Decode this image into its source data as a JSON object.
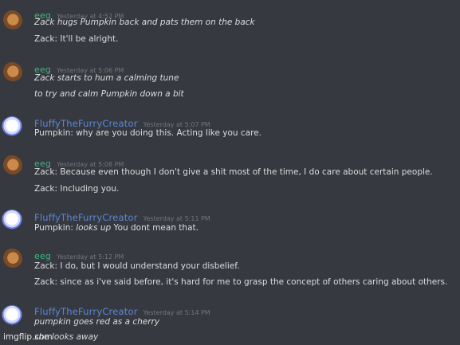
{
  "messages": [
    {
      "author": "eeg",
      "timestamp": "Yesterday at 4:52 PM",
      "lines": [
        "Zack hugs Pumpkin back and pats them on the back",
        "Zack: It'll be alright."
      ],
      "italic": [
        true,
        false
      ]
    },
    {
      "author": "eeg",
      "timestamp": "Yesterday at 5:06 PM",
      "lines": [
        "Zack starts to hum a calming tune",
        "to try and calm Pumpkin down a bit"
      ],
      "italic": [
        true,
        true
      ]
    },
    {
      "author": "FluffyTheFurryCreator",
      "timestamp": "Yesterday at 5:07 PM",
      "lines": [
        "Pumpkin: why are you doing this. Acting like you care."
      ]
    },
    {
      "author": "eeg",
      "timestamp": "Yesterday at 5:08 PM",
      "lines": [
        "Zack: Because even though I don't give a shit most of the time, I do care about certain people.",
        "Zack: Including you."
      ]
    },
    {
      "author": "FluffyTheFurryCreator",
      "timestamp": "Yesterday at 5:11 PM",
      "line_parts": [
        "Pumpkin: ",
        "looks up",
        " You dont mean that."
      ]
    },
    {
      "author": "eeg",
      "timestamp": "Yesterday at 5:12 PM",
      "lines": [
        "Zack: I do, but I would understand your disbelief.",
        "Zack: since as i've said before, it's hard for me to grasp the concept of others caring about others."
      ]
    },
    {
      "author": "FluffyTheFurryCreator",
      "timestamp": "Yesterday at 5:14 PM",
      "lines": [
        "pumpkin goes red as a cherry",
        "she looks away"
      ],
      "italic": [
        true,
        true
      ]
    }
  ],
  "watermark": "imgflip.com",
  "colors": {
    "background": "#36393f",
    "eeg_name": "#43b581",
    "fluffy_name": "#5b88d6",
    "text": "#dcddde",
    "timestamp": "#72767d"
  }
}
